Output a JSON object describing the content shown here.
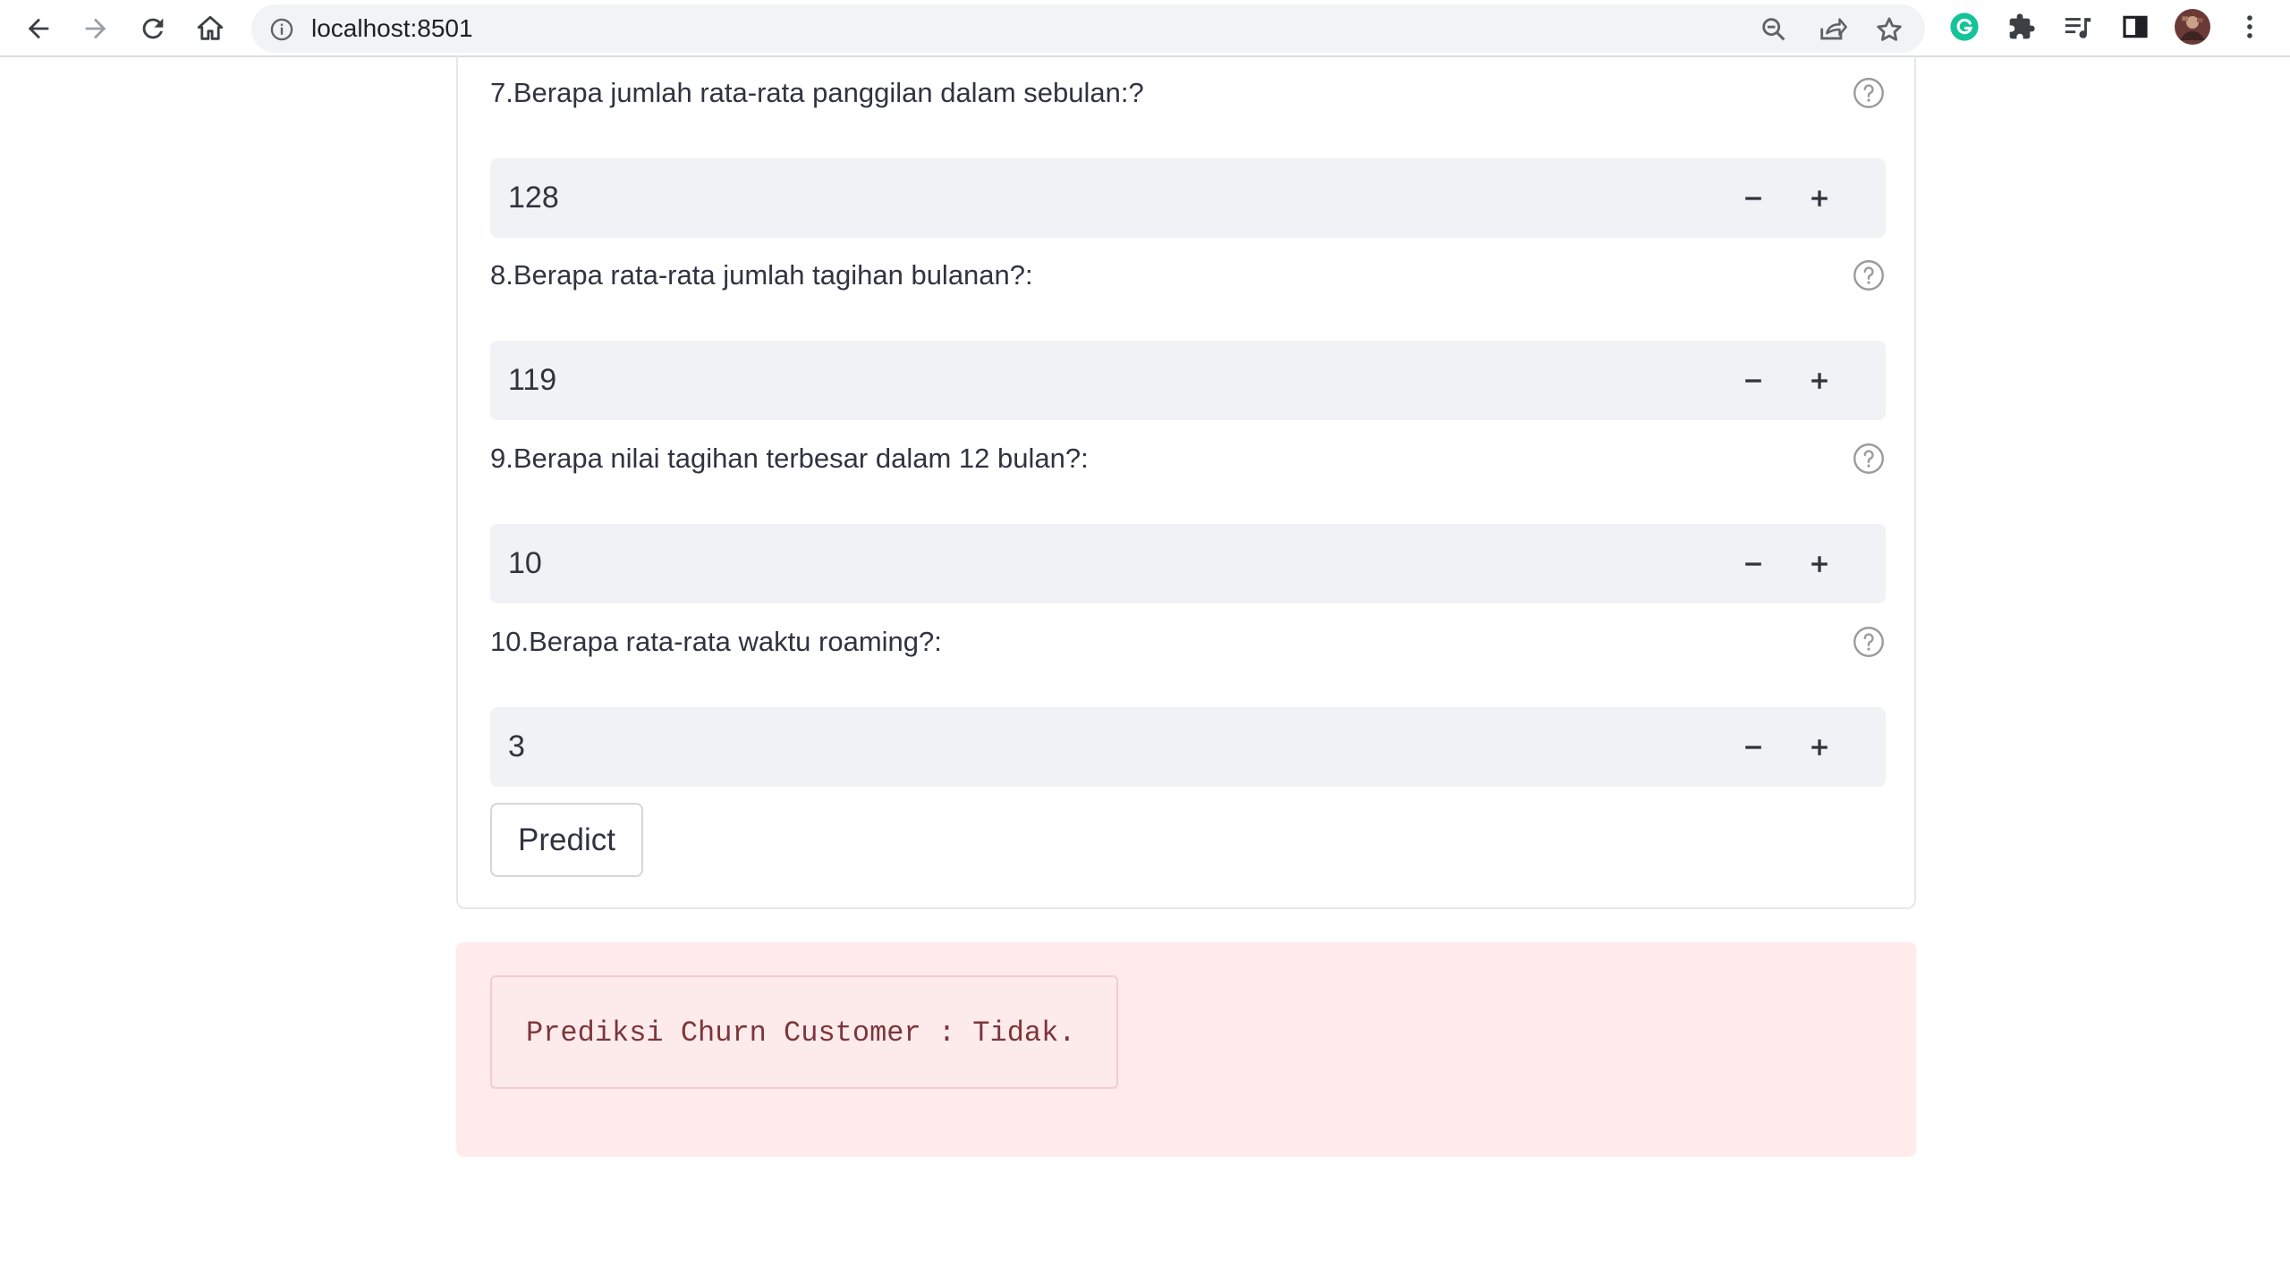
{
  "browser": {
    "url": "localhost:8501",
    "icons": {
      "back": "arrow-left-icon",
      "forward": "arrow-right-icon",
      "reload": "reload-icon",
      "home": "home-icon",
      "site_info": "info-icon",
      "zoom": "zoom-icon",
      "share": "share-icon",
      "bookmark": "star-icon",
      "grammarly": "grammarly-icon",
      "extensions": "puzzle-icon",
      "reading_list": "reading-list-icon",
      "side_panel": "side-panel-icon",
      "profile": "avatar",
      "menu": "kebab-menu-icon"
    },
    "colors": {
      "grammarly": "#15c39a"
    }
  },
  "form": {
    "questions": [
      {
        "label": "7.Berapa jumlah rata-rata panggilan dalam sebulan:?",
        "value": "128"
      },
      {
        "label": "8.Berapa rata-rata jumlah tagihan bulanan?:",
        "value": "119"
      },
      {
        "label": "9.Berapa nilai tagihan terbesar dalam 12 bulan?:",
        "value": "10"
      },
      {
        "label": "10.Berapa rata-rata waktu roaming?:",
        "value": "3"
      }
    ],
    "predict_label": "Predict"
  },
  "result": {
    "text": "Prediksi Churn Customer : Tidak.",
    "colors": {
      "background": "#ffebec",
      "text": "#7d353b"
    }
  }
}
